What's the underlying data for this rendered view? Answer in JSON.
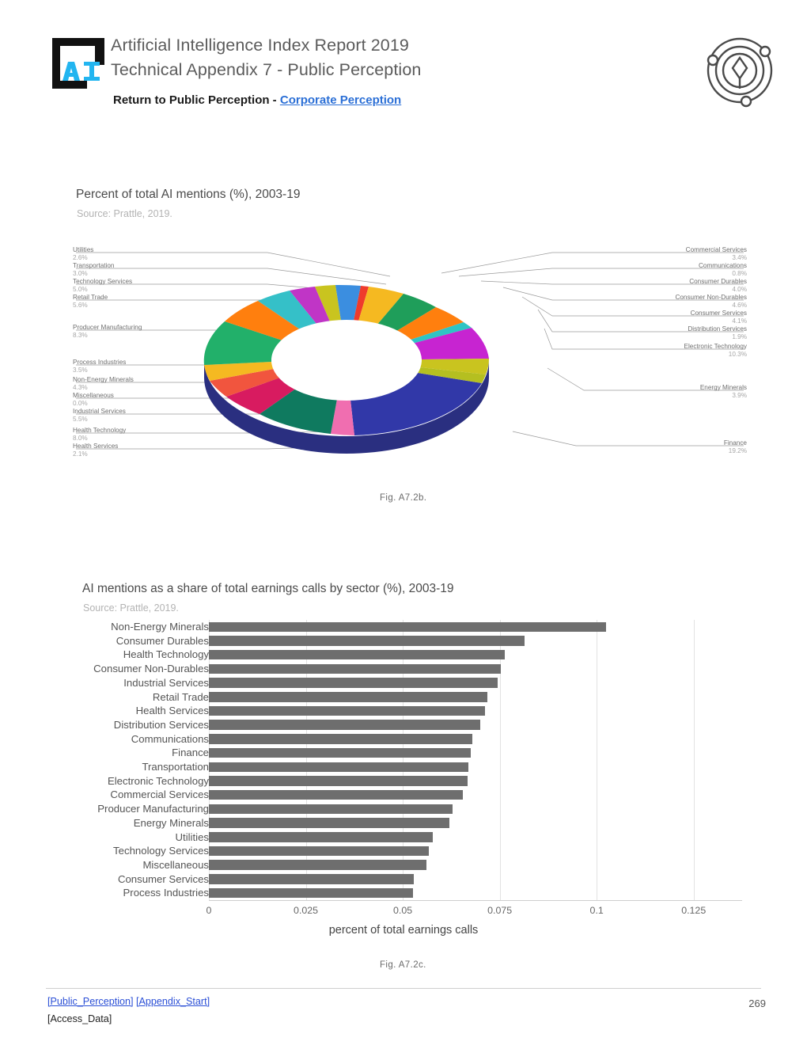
{
  "header": {
    "title_line1": "Artificial Intelligence Index Report 2019",
    "title_line2": "Technical Appendix 7 - Public Perception",
    "subtitle_prefix": "Return to Public Perception - ",
    "subtitle_link": "Corporate Perception",
    "logo_text": "AI",
    "logo_icon": "ai-bracket-logo",
    "orbit_icon": "atom-orbit-logo"
  },
  "figure1": {
    "title": "Percent of total AI mentions (%), 2003-19",
    "source": "Source: Prattle, 2019.",
    "caption": "Fig. A7.2b.",
    "chart_data": {
      "type": "pie",
      "title": "Percent of total AI mentions (%), 2003-19",
      "subtitle": "Source: Prattle, 2019.",
      "unit": "%",
      "legend": "leader-line labels, left and right of donut",
      "slices": [
        {
          "label": "Commercial Services",
          "value": 3.4,
          "value_label": "3.4%",
          "color": "#1f9e5a",
          "side": "right"
        },
        {
          "label": "Communications",
          "value": 0.8,
          "value_label": "0.8%",
          "color": "#ff7f0e",
          "side": "right"
        },
        {
          "label": "Consumer Durables",
          "value": 4.0,
          "value_label": "4.0%",
          "color": "#2ec4c4",
          "side": "right"
        },
        {
          "label": "Consumer Non-Durables",
          "value": 4.6,
          "value_label": "4.6%",
          "color": "#c724d1",
          "side": "right"
        },
        {
          "label": "Consumer Services",
          "value": 4.1,
          "value_label": "4.1%",
          "color": "#c9c41f",
          "side": "right"
        },
        {
          "label": "Distribution Services",
          "value": 1.9,
          "value_label": "1.9%",
          "color": "#2a4fc0",
          "side": "right"
        },
        {
          "label": "Electronic Technology",
          "value": 10.3,
          "value_label": "10.3%",
          "color": "#3a3f9e",
          "side": "right"
        },
        {
          "label": "Energy Minerals",
          "value": 3.9,
          "value_label": "3.9%",
          "color": "#2a4fc0",
          "side": "right"
        },
        {
          "label": "Finance",
          "value": 19.2,
          "value_label": "19.2%",
          "color": "#3138a8",
          "side": "right"
        },
        {
          "label": "Health Services",
          "value": 2.1,
          "value_label": "2.1%",
          "color": "#f06eb0",
          "side": "left"
        },
        {
          "label": "Health Technology",
          "value": 8.0,
          "value_label": "8.0%",
          "color": "#118a6e",
          "side": "left"
        },
        {
          "label": "Industrial Services",
          "value": 5.5,
          "value_label": "5.5%",
          "color": "#d81b60",
          "side": "left"
        },
        {
          "label": "Miscellaneous",
          "value": 0.0,
          "value_label": "0.0%",
          "color": "#f1553e",
          "side": "left"
        },
        {
          "label": "Non-Energy Minerals",
          "value": 4.3,
          "value_label": "4.3%",
          "color": "#f5b921",
          "side": "left"
        },
        {
          "label": "Process Industries",
          "value": 3.5,
          "value_label": "3.5%",
          "color": "#22b06a",
          "side": "left"
        },
        {
          "label": "Producer Manufacturing",
          "value": 8.3,
          "value_label": "8.3%",
          "color": "#ff7f0e",
          "side": "left"
        },
        {
          "label": "Retail Trade",
          "value": 5.6,
          "value_label": "5.6%",
          "color": "#35c0c8",
          "side": "left"
        },
        {
          "label": "Technology Services",
          "value": 5.0,
          "value_label": "5.0%",
          "color": "#c035c6",
          "side": "left"
        },
        {
          "label": "Transportation",
          "value": 3.0,
          "value_label": "3.0%",
          "color": "#c9c41f",
          "side": "left"
        },
        {
          "label": "Utilities",
          "value": 2.6,
          "value_label": "2.6%",
          "color": "#3b8ee0",
          "side": "left"
        }
      ]
    },
    "left_labels": [
      {
        "name": "Utilities",
        "pct": "2.6%"
      },
      {
        "name": "Transportation",
        "pct": "3.0%"
      },
      {
        "name": "Technology Services",
        "pct": "5.0%"
      },
      {
        "name": "Retail Trade",
        "pct": "5.6%"
      },
      {
        "name": "Producer Manufacturing",
        "pct": "8.3%"
      },
      {
        "name": "Process Industries",
        "pct": "3.5%"
      },
      {
        "name": "Non-Energy Minerals",
        "pct": "4.3%"
      },
      {
        "name": "Miscellaneous",
        "pct": "0.0%"
      },
      {
        "name": "Industrial Services",
        "pct": "5.5%"
      },
      {
        "name": "Health Technology",
        "pct": "8.0%"
      },
      {
        "name": "Health Services",
        "pct": "2.1%"
      }
    ],
    "right_labels": [
      {
        "name": "Commercial Services",
        "pct": "3.4%"
      },
      {
        "name": "Communications",
        "pct": "0.8%"
      },
      {
        "name": "Consumer Durables",
        "pct": "4.0%"
      },
      {
        "name": "Consumer Non-Durables",
        "pct": "4.6%"
      },
      {
        "name": "Consumer Services",
        "pct": "4.1%"
      },
      {
        "name": "Distribution Services",
        "pct": "1.9%"
      },
      {
        "name": "Electronic Technology",
        "pct": "10.3%"
      },
      {
        "name": "Energy Minerals",
        "pct": "3.9%"
      },
      {
        "name": "Finance",
        "pct": "19.2%"
      }
    ]
  },
  "figure2": {
    "title": "AI mentions as a share of total earnings calls by sector (%), 2003-19",
    "source": "Source: Prattle, 2019.",
    "caption": "Fig. A7.2c.",
    "chart_data": {
      "type": "bar",
      "orientation": "horizontal",
      "title": "AI mentions as a share of total earnings calls by sector (%), 2003-19",
      "subtitle": "Source: Prattle, 2019.",
      "xlabel": "percent of total earnings calls",
      "ylabel": "",
      "xlim": [
        0,
        0.1375
      ],
      "xticks": [
        "0",
        "0.025",
        "0.05",
        "0.075",
        "0.1",
        "0.125"
      ],
      "xtick_values": [
        0,
        0.025,
        0.05,
        0.075,
        0.1,
        0.125
      ],
      "grid": true,
      "bar_color": "#6e6e6e",
      "categories": [
        "Non-Energy Minerals",
        "Consumer Durables",
        "Health Technology",
        "Consumer Non-Durables",
        "Industrial Services",
        "Retail Trade",
        "Health Services",
        "Distribution Services",
        "Communications",
        "Finance",
        "Transportation",
        "Electronic Technology",
        "Commercial Services",
        "Producer Manufacturing",
        "Energy Minerals",
        "Utilities",
        "Technology Services",
        "Miscellaneous",
        "Consumer Services",
        "Process Industries"
      ],
      "values": [
        0.1025,
        0.0815,
        0.0762,
        0.0752,
        0.0745,
        0.0718,
        0.0712,
        0.07,
        0.068,
        0.0675,
        0.067,
        0.0667,
        0.0655,
        0.0628,
        0.062,
        0.0578,
        0.0568,
        0.0562,
        0.0528,
        0.0527
      ]
    }
  },
  "footer": {
    "line1_link1": "[Public_Perception]",
    "line1_sep": " ",
    "line1_link2": "[Appendix_Start]",
    "line2": "[Access_Data]",
    "page_number": "269"
  }
}
